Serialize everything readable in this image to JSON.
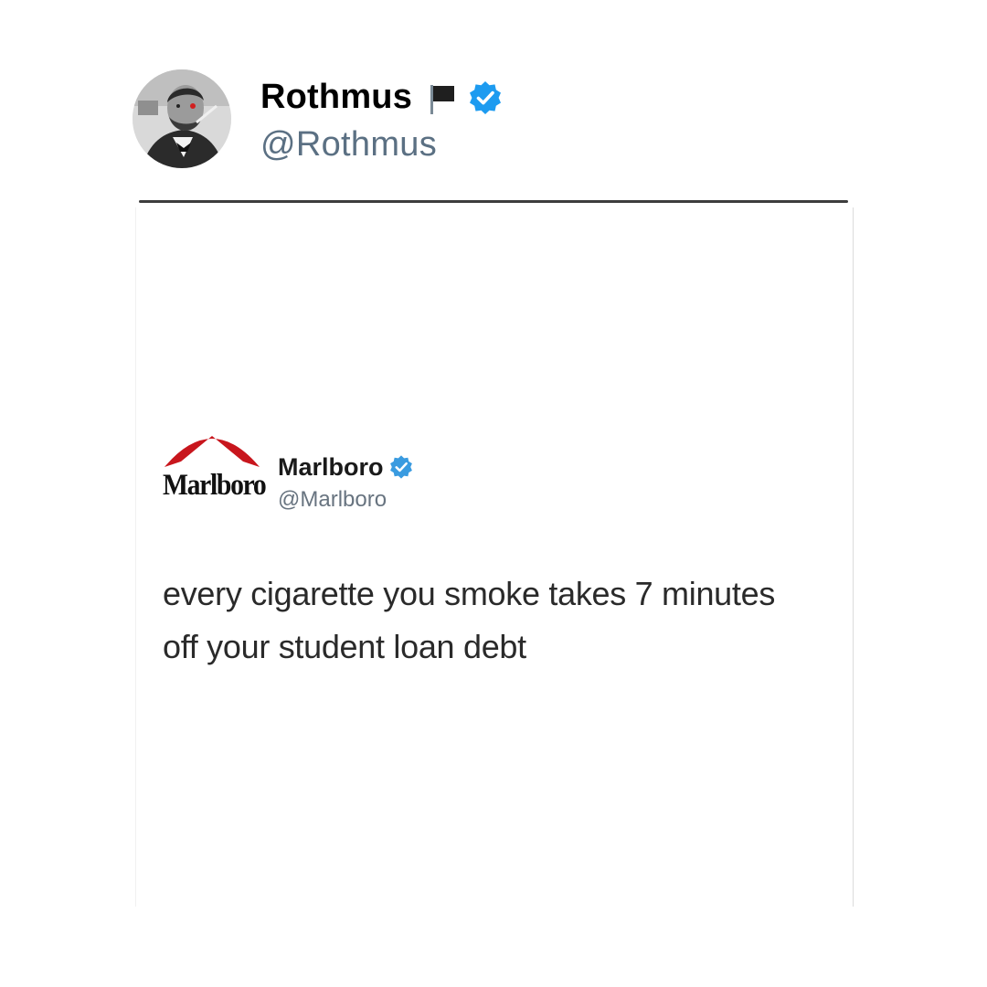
{
  "outer_tweet": {
    "display_name": "Rothmus",
    "handle": "@Rothmus",
    "icons": [
      "avatar",
      "black-flag-icon",
      "verified-badge-icon"
    ]
  },
  "embedded_tweet": {
    "brand_wordmark": "Marlboro",
    "display_name": "Marlboro",
    "handle": "@Marlboro",
    "text_line_1": "every cigarette you smoke takes 7 minutes",
    "text_line_2": "off your student loan debt",
    "icons": [
      "marlboro-logo",
      "verified-badge-icon"
    ]
  },
  "colors": {
    "verified_blue": "#1d9bf0",
    "handle_gray": "#5b7083",
    "marlboro_red": "#c8161d"
  }
}
